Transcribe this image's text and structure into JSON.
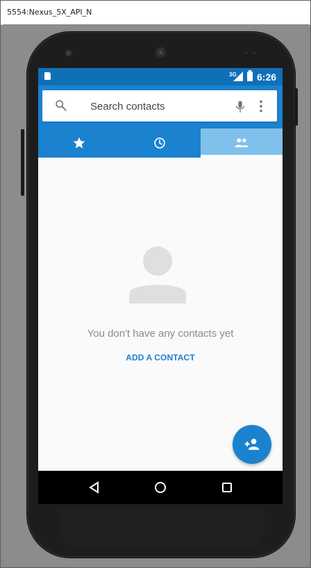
{
  "window": {
    "title": "5554:Nexus_5X_API_N"
  },
  "status_bar": {
    "network": "3G",
    "time": "6:26"
  },
  "search": {
    "placeholder": "Search contacts"
  },
  "tabs": [
    {
      "name": "favorites",
      "icon": "star-icon",
      "selected": false
    },
    {
      "name": "recent",
      "icon": "clock-icon",
      "selected": false
    },
    {
      "name": "contacts",
      "icon": "people-icon",
      "selected": true
    }
  ],
  "empty_state": {
    "message": "You don't have any contacts yet",
    "action": "ADD A CONTACT"
  },
  "fab": {
    "icon": "add-person-icon"
  },
  "colors": {
    "accent": "#1b82cf",
    "status_bar": "#0f70b8",
    "selected_tab": "#80c1ec"
  }
}
